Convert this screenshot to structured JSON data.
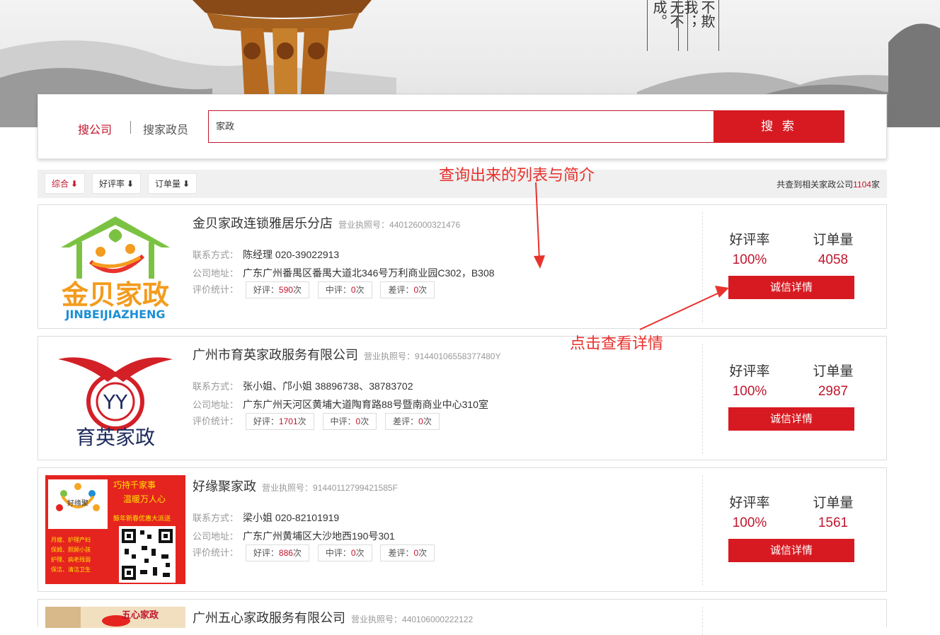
{
  "banner": {
    "poem_left": "无不成。",
    "poem_right": "不欺我；"
  },
  "search": {
    "tabs": [
      {
        "label": "搜公司"
      },
      {
        "label": "搜家政员"
      }
    ],
    "query": "家政",
    "button_label": "搜 索"
  },
  "sort": {
    "options": [
      {
        "label": "综合"
      },
      {
        "label": "好评率"
      },
      {
        "label": "订单量"
      }
    ],
    "arrow": "⬇",
    "total_prefix": "共查到相关家政公司",
    "total_count": "1104",
    "total_suffix": "家"
  },
  "labels": {
    "license": "营业执照号：",
    "contact": "联系方式：",
    "address": "公司地址：",
    "reviews": "评价统计：",
    "good": "好评：",
    "mid": "中评：",
    "bad": "差评：",
    "times": "次",
    "rate_title": "好评率",
    "orders_title": "订单量",
    "detail_button": "诚信详情"
  },
  "companies": [
    {
      "name": "金贝家政连锁雅居乐分店",
      "license": "440126000321476",
      "contact": "陈经理 020-39022913",
      "address": "广东广州番禺区番禺大道北346号万利商业园C302，B308",
      "good": "590",
      "mid": "0",
      "bad": "0",
      "rate": "100%",
      "orders": "4058",
      "logo_text": "金贝家政",
      "logo_sub": "JINBEIJIAZHENG"
    },
    {
      "name": "广州市育英家政服务有限公司",
      "license": "91440106558377480Y",
      "contact": "张小姐、邝小姐 38896738、38783702",
      "address": "广东广州天河区黄埔大道陶育路88号暨南商业中心310室",
      "good": "1701",
      "mid": "0",
      "bad": "0",
      "rate": "100%",
      "orders": "2987",
      "logo_text": "育英家政",
      "logo_sub": "YY"
    },
    {
      "name": "好缘聚家政",
      "license": "91440112799421585F",
      "contact": "梁小姐 020-82101919",
      "address": "广东广州黄埔区大沙地西190号301",
      "good": "886",
      "mid": "0",
      "bad": "0",
      "rate": "100%",
      "orders": "1561",
      "logo_text": "好缘聚",
      "logo_slogan_1": "巧持千家事",
      "logo_slogan_2": "温暖万人心",
      "logo_promo": "鲸年新春优惠大派送",
      "logo_lines": [
        "月嫂、护理产妇",
        "保姆、照顾小孩",
        "护理、病老残弱",
        "保洁、清洁卫生"
      ]
    },
    {
      "name": "广州五心家政服务有限公司",
      "license": "440106000222122",
      "logo_text": "五心家政"
    }
  ],
  "annotations": {
    "list_note": "查询出来的列表与简介",
    "detail_note": "点击查看详情"
  },
  "colors": {
    "brand_red": "#d71a21",
    "accent_red": "#c0162d",
    "annotation_red": "#e8322e"
  }
}
